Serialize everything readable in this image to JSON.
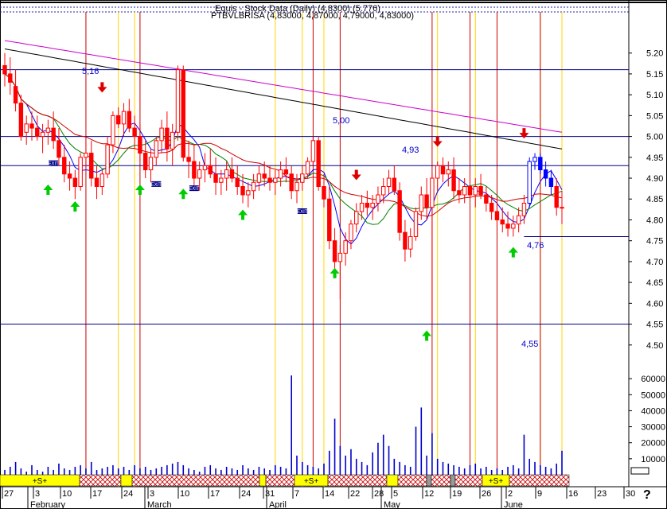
{
  "header": {
    "line1": "Equis - Stock Data (Daily) (4,8300)  (5.776)",
    "line2": "PTBVLBRISA (4,83000, 4,87000, 4,79000, 4,83000)"
  },
  "help_mark": "?",
  "chart_data": {
    "type": "candlestick",
    "price_axis": {
      "ylim": [
        4.45,
        5.27
      ],
      "ticks": [
        "5.20",
        "5.15",
        "5.10",
        "5.05",
        "5.00",
        "4.95",
        "4.90",
        "4.85",
        "4.80",
        "4.75",
        "4.70",
        "4.65",
        "4.60",
        "4.55",
        "4.50"
      ]
    },
    "volume_axis": {
      "ylim": [
        0,
        68000
      ],
      "ticks": [
        "60000",
        "50000",
        "40000",
        "30000",
        "20000",
        "10000"
      ]
    },
    "time_axis": {
      "day_labels": [
        "27",
        "3",
        "10",
        "17",
        "24",
        "3",
        "10",
        "17",
        "24",
        "31",
        "7",
        "14",
        "22",
        "28",
        "5",
        "12",
        "19",
        "26",
        "2",
        "9",
        "16",
        "23",
        "30"
      ],
      "month_labels": [
        "February",
        "March",
        "April",
        "May",
        "June"
      ]
    },
    "levels": [
      {
        "value": 5.16,
        "label": "5,16"
      },
      {
        "value": 5.0,
        "label": "5,00"
      },
      {
        "value": 4.93,
        "label": "4,93"
      },
      {
        "value": 4.76,
        "label": "4,76"
      },
      {
        "value": 4.55,
        "label": "4,55"
      }
    ],
    "exit_labels": [
      "EXIT",
      "EXIT",
      "EXIT",
      "EXIT",
      "EXIT"
    ],
    "signal_labels": [
      "+S+",
      "+S+",
      "+S+"
    ],
    "bars": [
      [
        5.17,
        5.2,
        5.12,
        5.15,
        3000
      ],
      [
        5.15,
        5.19,
        5.1,
        5.13,
        5000
      ],
      [
        5.12,
        5.16,
        5.06,
        5.08,
        8000
      ],
      [
        5.08,
        5.1,
        4.99,
        5.0,
        4000
      ],
      [
        5.01,
        5.05,
        4.98,
        5.03,
        2000
      ],
      [
        5.03,
        5.06,
        4.99,
        5.02,
        6000
      ],
      [
        5.02,
        5.05,
        4.99,
        5.0,
        3000
      ],
      [
        5.0,
        5.03,
        4.96,
        5.01,
        2000
      ],
      [
        5.01,
        5.04,
        4.98,
        5.02,
        5000
      ],
      [
        5.02,
        5.06,
        4.97,
        4.99,
        3000
      ],
      [
        4.99,
        5.02,
        4.93,
        4.95,
        7000
      ],
      [
        4.95,
        4.98,
        4.89,
        4.91,
        4000
      ],
      [
        4.91,
        4.94,
        4.87,
        4.9,
        3000
      ],
      [
        4.9,
        4.92,
        4.85,
        4.88,
        5000
      ],
      [
        4.88,
        4.96,
        4.87,
        4.95,
        6000
      ],
      [
        4.95,
        4.99,
        4.92,
        4.96,
        4000
      ],
      [
        4.96,
        4.99,
        4.88,
        4.9,
        8000
      ],
      [
        4.9,
        4.93,
        4.85,
        4.88,
        3000
      ],
      [
        4.88,
        4.92,
        4.86,
        4.91,
        4000
      ],
      [
        4.91,
        5.0,
        4.9,
        4.98,
        5000
      ],
      [
        4.98,
        5.06,
        4.96,
        5.05,
        6000
      ],
      [
        5.05,
        5.07,
        5.02,
        5.03,
        4000
      ],
      [
        5.03,
        5.08,
        5.0,
        5.06,
        5000
      ],
      [
        5.06,
        5.09,
        5.01,
        5.02,
        3000
      ],
      [
        5.02,
        5.05,
        4.97,
        5.0,
        6000
      ],
      [
        5.0,
        5.03,
        4.94,
        4.96,
        4000
      ],
      [
        4.96,
        4.99,
        4.9,
        4.92,
        5000
      ],
      [
        4.92,
        4.97,
        4.89,
        4.95,
        3000
      ],
      [
        4.95,
        5.0,
        4.93,
        4.99,
        4000
      ],
      [
        4.99,
        5.04,
        4.96,
        5.02,
        5000
      ],
      [
        5.02,
        5.06,
        4.94,
        4.97,
        6000
      ],
      [
        4.97,
        5.03,
        4.93,
        5.01,
        7000
      ],
      [
        5.01,
        5.17,
        4.99,
        5.16,
        8000
      ],
      [
        5.16,
        5.17,
        4.94,
        4.95,
        6000
      ],
      [
        4.95,
        4.99,
        4.9,
        4.94,
        4000
      ],
      [
        4.94,
        4.98,
        4.88,
        4.9,
        3000
      ],
      [
        4.9,
        4.94,
        4.87,
        4.92,
        2000
      ],
      [
        4.92,
        4.96,
        4.89,
        4.93,
        5000
      ],
      [
        4.93,
        4.97,
        4.9,
        4.91,
        6000
      ],
      [
        4.91,
        4.95,
        4.86,
        4.89,
        4000
      ],
      [
        4.89,
        4.92,
        4.86,
        4.9,
        3000
      ],
      [
        4.9,
        4.94,
        4.87,
        4.92,
        5000
      ],
      [
        4.92,
        4.95,
        4.89,
        4.9,
        4000
      ],
      [
        4.9,
        4.93,
        4.86,
        4.88,
        3000
      ],
      [
        4.88,
        4.91,
        4.84,
        4.86,
        6000
      ],
      [
        4.86,
        4.89,
        4.83,
        4.87,
        4000
      ],
      [
        4.87,
        4.91,
        4.85,
        4.89,
        3000
      ],
      [
        4.89,
        4.93,
        4.87,
        4.91,
        5000
      ],
      [
        4.91,
        4.94,
        4.88,
        4.9,
        4000
      ],
      [
        4.9,
        4.93,
        4.87,
        4.89,
        3000
      ],
      [
        4.89,
        4.92,
        4.86,
        4.9,
        6000
      ],
      [
        4.9,
        4.94,
        4.88,
        4.92,
        5000
      ],
      [
        4.92,
        4.95,
        4.89,
        4.91,
        4000
      ],
      [
        4.91,
        4.93,
        4.85,
        4.87,
        62000
      ],
      [
        4.87,
        4.91,
        4.84,
        4.89,
        12000
      ],
      [
        4.89,
        4.93,
        4.87,
        4.91,
        8000
      ],
      [
        4.91,
        4.95,
        4.9,
        4.94,
        6000
      ],
      [
        4.94,
        5.0,
        4.93,
        4.99,
        5000
      ],
      [
        4.99,
        5.0,
        4.87,
        4.88,
        4000
      ],
      [
        4.88,
        4.91,
        4.83,
        4.85,
        7000
      ],
      [
        4.85,
        4.88,
        4.73,
        4.75,
        15000
      ],
      [
        4.75,
        4.78,
        4.68,
        4.7,
        35000
      ],
      [
        4.7,
        4.74,
        4.61,
        4.72,
        18000
      ],
      [
        4.72,
        4.77,
        4.69,
        4.75,
        12000
      ],
      [
        4.75,
        4.8,
        4.73,
        4.79,
        16000
      ],
      [
        4.79,
        4.84,
        4.77,
        4.82,
        10000
      ],
      [
        4.82,
        4.86,
        4.8,
        4.84,
        8000
      ],
      [
        4.84,
        4.87,
        4.81,
        4.83,
        6000
      ],
      [
        4.83,
        4.86,
        4.8,
        4.84,
        14000
      ],
      [
        4.84,
        4.88,
        4.82,
        4.86,
        20000
      ],
      [
        4.86,
        4.9,
        4.84,
        4.88,
        25000
      ],
      [
        4.88,
        4.92,
        4.86,
        4.9,
        18000
      ],
      [
        4.9,
        4.93,
        4.86,
        4.87,
        10000
      ],
      [
        4.87,
        4.89,
        4.75,
        4.77,
        8000
      ],
      [
        4.77,
        4.8,
        4.7,
        4.73,
        6000
      ],
      [
        4.73,
        4.78,
        4.71,
        4.76,
        5000
      ],
      [
        4.76,
        4.83,
        4.75,
        4.82,
        30000
      ],
      [
        4.82,
        4.88,
        4.8,
        4.86,
        42000
      ],
      [
        4.86,
        4.9,
        4.8,
        4.83,
        12000
      ],
      [
        4.83,
        4.91,
        4.55,
        4.9,
        26000
      ],
      [
        4.9,
        4.94,
        4.87,
        4.93,
        10000
      ],
      [
        4.93,
        4.95,
        4.89,
        4.91,
        8000
      ],
      [
        4.91,
        4.94,
        4.88,
        4.92,
        7000
      ],
      [
        4.92,
        4.95,
        4.85,
        4.87,
        6000
      ],
      [
        4.87,
        4.9,
        4.84,
        4.86,
        5000
      ],
      [
        4.86,
        4.9,
        4.84,
        4.88,
        4000
      ],
      [
        4.88,
        4.92,
        4.85,
        4.86,
        6000
      ],
      [
        4.86,
        4.9,
        4.83,
        4.88,
        7000
      ],
      [
        4.88,
        4.91,
        4.85,
        4.86,
        4000
      ],
      [
        4.86,
        4.88,
        4.82,
        4.84,
        5000
      ],
      [
        4.84,
        4.86,
        4.8,
        4.82,
        3000
      ],
      [
        4.82,
        4.85,
        4.79,
        4.8,
        4000
      ],
      [
        4.8,
        4.83,
        4.77,
        4.79,
        3000
      ],
      [
        4.79,
        4.82,
        4.76,
        4.78,
        5000
      ],
      [
        4.78,
        4.81,
        4.76,
        4.79,
        6000
      ],
      [
        4.79,
        4.83,
        4.77,
        4.81,
        4000
      ],
      [
        4.81,
        4.86,
        4.79,
        4.84,
        25000
      ],
      [
        4.84,
        4.95,
        4.83,
        4.94,
        10000
      ],
      [
        4.94,
        4.96,
        4.92,
        4.95,
        8000
      ],
      [
        4.95,
        4.96,
        4.91,
        4.92,
        6000
      ],
      [
        4.92,
        4.94,
        4.88,
        4.9,
        5000
      ],
      [
        4.9,
        4.92,
        4.86,
        4.88,
        4000
      ],
      [
        4.88,
        4.9,
        4.81,
        4.83,
        7000
      ],
      [
        4.83,
        4.87,
        4.79,
        4.83,
        15000
      ]
    ]
  }
}
